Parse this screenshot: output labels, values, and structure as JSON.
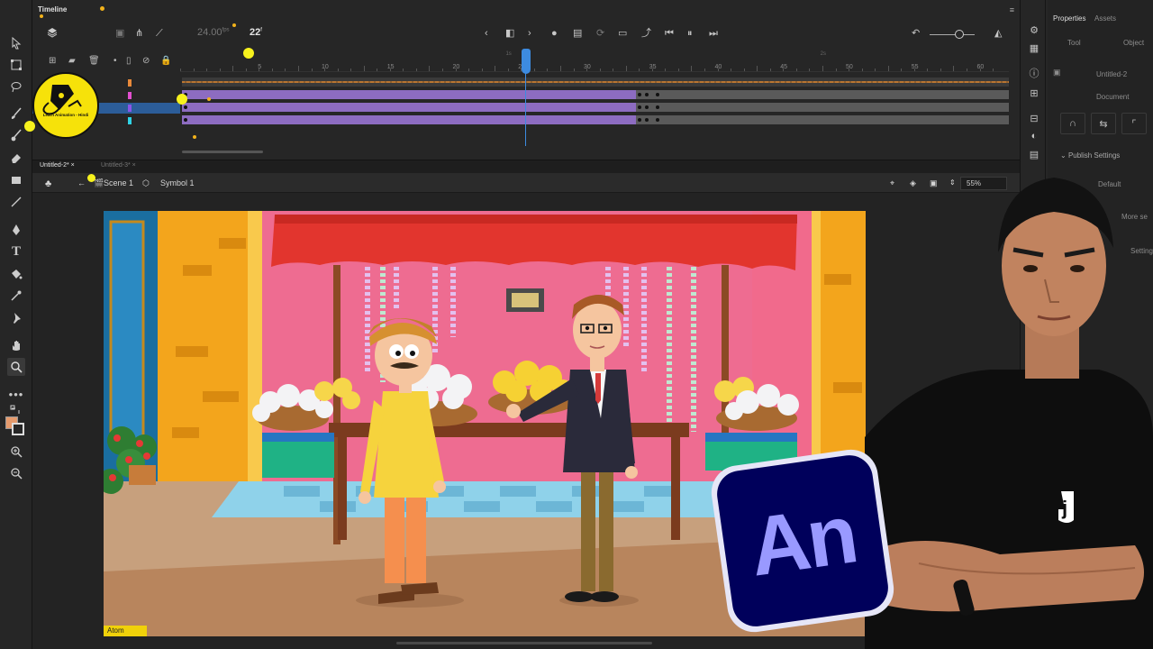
{
  "timeline": {
    "tab_label": "Timeline",
    "fps": "24.00",
    "fps_unit": "fps",
    "current_frame": "22",
    "current_frame_unit": "f",
    "ruler_labels": [
      "5",
      "10",
      "15",
      "20",
      "25",
      "30",
      "35",
      "40",
      "45",
      "50",
      "55",
      "60"
    ],
    "ruler_seconds": [
      "1s",
      "2s"
    ],
    "layers": [
      {
        "color": "#e8893a"
      },
      {
        "color": "#e24fd0"
      },
      {
        "color": "#8b55e8"
      },
      {
        "color": "#2fd3e6"
      }
    ]
  },
  "documents": {
    "tabs": [
      {
        "label": "Untitled-2*",
        "active": true
      },
      {
        "label": "Untitled-3*",
        "active": false
      }
    ]
  },
  "edit_bar": {
    "scene": "Scene 1",
    "symbol": "Symbol 1",
    "zoom": "55%"
  },
  "properties": {
    "panel_tabs": [
      "Properties",
      "Assets"
    ],
    "sub_tabs": [
      "Tool",
      "Object"
    ],
    "doc_name": "Untitled-2",
    "doc_type": "Document",
    "section": "Publish Settings",
    "profile": "Default",
    "more": "More se",
    "settings": "Settings"
  },
  "overlay": {
    "logo_text": "An",
    "badge_text": "Learn Animation - Hindi",
    "stage_caption": "Atom",
    "shirt_logo": "j"
  },
  "colors": {
    "accent": "#3d8be0",
    "tween": "#8d6cc1",
    "animate_logo_bg": "#00005b",
    "animate_logo_text": "#9999ff"
  }
}
